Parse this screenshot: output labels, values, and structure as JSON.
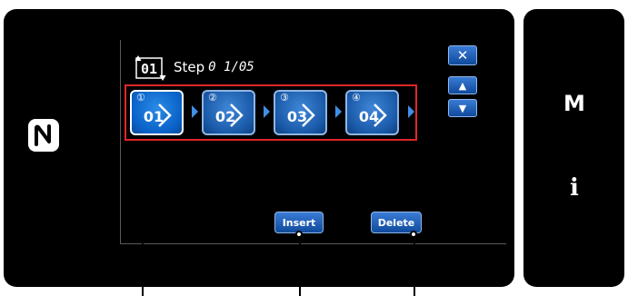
{
  "header": {
    "step_label": "Step",
    "step_number": "0 1/05",
    "step_icon_text": "01"
  },
  "controls": {
    "close": "✕",
    "up": "▲",
    "down": "▼"
  },
  "steps": [
    {
      "badge": "①",
      "text": "01",
      "selected": true
    },
    {
      "badge": "②",
      "text": "02",
      "selected": false
    },
    {
      "badge": "③",
      "text": "03",
      "selected": false
    },
    {
      "badge": "④",
      "text": "04",
      "selected": false
    }
  ],
  "actions": {
    "insert_label": "Insert",
    "delete_label": "Delete"
  },
  "side": {
    "menu_label": "M",
    "info_label": "i"
  },
  "colors": {
    "selection_frame": "#e0262a",
    "button_blue": "#1a5aa8",
    "arrow_blue": "#3f8fe6"
  }
}
